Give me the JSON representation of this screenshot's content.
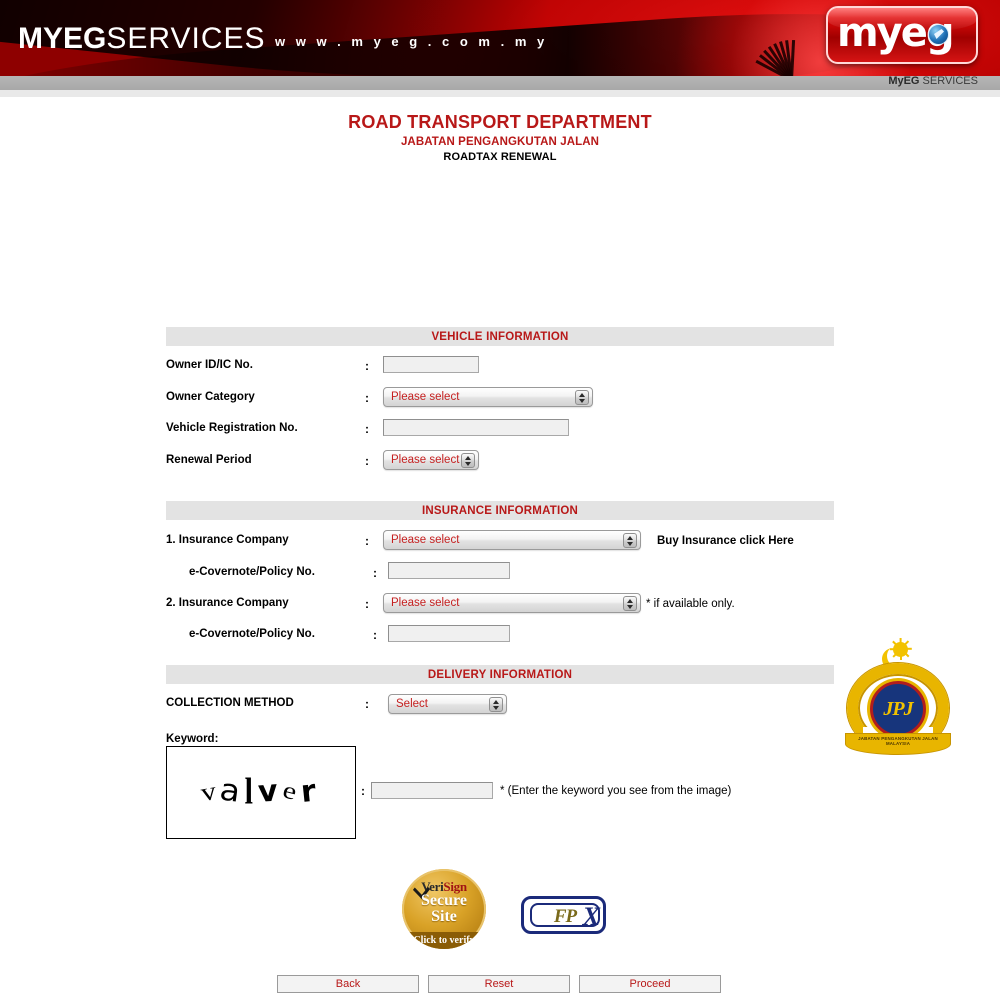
{
  "banner": {
    "title_bold": "MYEG",
    "title_thin": "SERVICES",
    "url": "w w w . m y e g . c o m . m y",
    "logo_text": "myeg",
    "logo_icon": "globe-swoosh-icon",
    "subbar_bold": "MyEG",
    "subbar_thin": " SERVICES",
    "accent_red": "#b81818",
    "banner_red": "#c80000"
  },
  "page": {
    "title": "ROAD TRANSPORT DEPARTMENT",
    "subtitle_my": "JABATAN PENGANGKUTAN JALAN",
    "subtitle_service": "ROADTAX RENEWAL"
  },
  "sections": {
    "vehicle": "VEHICLE INFORMATION",
    "insurance": "INSURANCE INFORMATION",
    "delivery": "DELIVERY INFORMATION"
  },
  "colon": ":",
  "vehicle": {
    "owner_id_label": "Owner ID/IC No.",
    "owner_id_value": "",
    "owner_category_label": "Owner Category",
    "owner_category_value": "Please select",
    "vehicle_reg_label": "Vehicle Registration No.",
    "vehicle_reg_value": "",
    "renewal_period_label": "Renewal Period",
    "renewal_period_value": "Please select"
  },
  "insurance": {
    "company1_label": "1. Insurance Company",
    "company1_value": "Please select",
    "buy_link": "Buy Insurance click Here",
    "covernote1_label": "e-Covernote/Policy No.",
    "covernote1_value": "",
    "company2_label": "2. Insurance Company",
    "company2_value": "Please select",
    "company2_note": "* if available only.",
    "covernote2_label": "e-Covernote/Policy No.",
    "covernote2_value": ""
  },
  "delivery": {
    "collection_label": "COLLECTION METHOD",
    "collection_value": "Select"
  },
  "captcha": {
    "label": "Keyword:",
    "image_text": "valver",
    "chars": [
      "v",
      "a",
      "l",
      "v",
      "e",
      "r"
    ],
    "input_value": "",
    "hint": "* (Enter the keyword you see from the image)"
  },
  "seals": {
    "verisign_brand_a": "Veri",
    "verisign_brand_b": "Sign",
    "verisign_line1": "Secure",
    "verisign_line2": "Site",
    "verisign_cta": "Click to verify",
    "fpx_text": "FP",
    "fpx_x": "X"
  },
  "jpj": {
    "monogram": "JPJ",
    "scroll_text": "JABATAN PENGANGKUTAN JALAN MALAYSIA"
  },
  "buttons": {
    "back": "Back",
    "reset": "Reset",
    "proceed": "Proceed"
  }
}
